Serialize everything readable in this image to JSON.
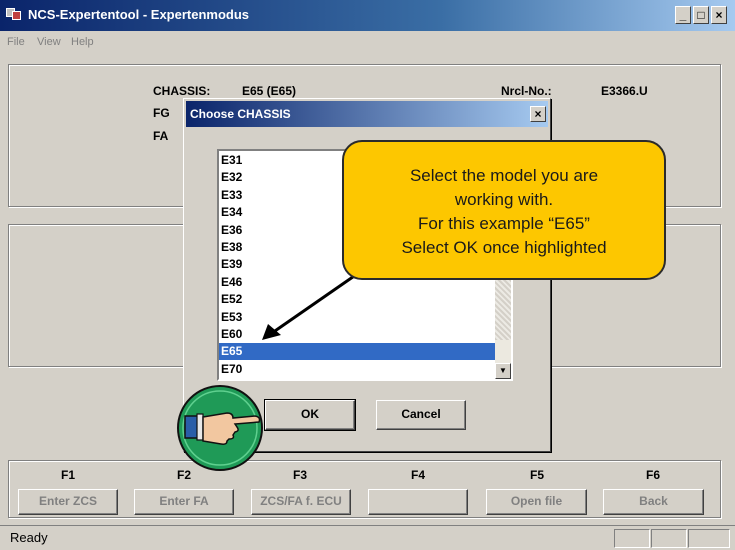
{
  "window": {
    "title": "NCS-Expertentool - Expertenmodus",
    "minimize": "_",
    "maximize": "□",
    "close": "×"
  },
  "menu": [
    "File",
    "View",
    "Help"
  ],
  "info": {
    "chassis_label": "CHASSIS:",
    "chassis_value": "E65 (E65)",
    "fg_label": "FG",
    "fa_label": "FA",
    "nrcl_label": "Nrcl-No.:",
    "nrcl_value": "E3366.U"
  },
  "dialog": {
    "title": "Choose CHASSIS",
    "close": "×",
    "items": [
      "E31",
      "E32",
      "E33",
      "E34",
      "E36",
      "E38",
      "E39",
      "E46",
      "E52",
      "E53",
      "E60",
      "E65",
      "E70"
    ],
    "selected": "E65",
    "ok": "OK",
    "cancel": "Cancel"
  },
  "callout": {
    "line1": "Select the model you are",
    "line2": "working with.",
    "line3": "For this example “E65”",
    "line4": "Select OK once highlighted"
  },
  "fkeys": [
    {
      "key": "F1",
      "label": "Enter ZCS"
    },
    {
      "key": "F2",
      "label": "Enter FA"
    },
    {
      "key": "F3",
      "label": "ZCS/FA f. ECU"
    },
    {
      "key": "F4",
      "label": ""
    },
    {
      "key": "F5",
      "label": "Open file"
    },
    {
      "key": "F6",
      "label": "Back"
    }
  ],
  "status": {
    "text": "Ready"
  },
  "colors": {
    "selection": "#316ac5",
    "callout": "#fdc700",
    "hand_badge": "#1f9a57"
  }
}
